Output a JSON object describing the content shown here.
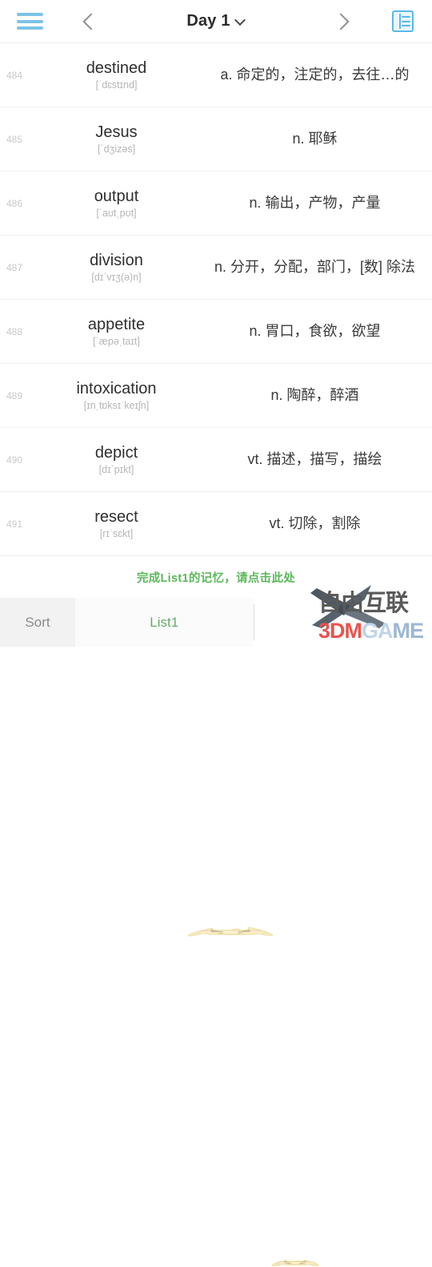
{
  "header": {
    "menu_icon": "hamburger-menu-icon",
    "prev_icon": "chevron-left-icon",
    "title": "Day 1",
    "caret_icon": "chevron-down-icon",
    "next_icon": "chevron-right-icon",
    "grid_icon": "table-list-icon"
  },
  "words": [
    {
      "index": "484",
      "word": "destined",
      "ipa": "[ˈdɛstɪnd]",
      "definition": "a. 命定的，注定的，去往…的"
    },
    {
      "index": "485",
      "word": "Jesus",
      "ipa": "[ˈdʒizəs]",
      "definition": "n. 耶稣"
    },
    {
      "index": "486",
      "word": "output",
      "ipa": "[ˈaʊtˌpʊt]",
      "definition": "n. 输出，产物，产量"
    },
    {
      "index": "487",
      "word": "division",
      "ipa": "[dɪˈvɪʒ(ə)n]",
      "definition": "n. 分开，分配，部门，[数] 除法"
    },
    {
      "index": "488",
      "word": "appetite",
      "ipa": "[ˈæpəˌtaɪt]",
      "definition": "n. 胃口，食欲，欲望"
    },
    {
      "index": "489",
      "word": "intoxication",
      "ipa": "[ɪnˌtɒksɪˈkeɪʃn]",
      "definition": "n. 陶醉，醉酒"
    },
    {
      "index": "490",
      "word": "depict",
      "ipa": "[dɪˈpɪkt]",
      "definition": "vt. 描述，描写，描绘"
    },
    {
      "index": "491",
      "word": "resect",
      "ipa": "[rɪˈsɛkt]",
      "definition": "vt. 切除，割除"
    }
  ],
  "hint": {
    "text": "完成List1的记忆，请点击此处",
    "color": "#5cb85c"
  },
  "tabbar": {
    "sort_label": "Sort",
    "list_label": "List1"
  },
  "watermarks": {
    "site_name": "自由互联",
    "game_name_1": "3DM",
    "game_name_2": "GA",
    "game_name_3": "ME",
    "mascot": "chick-mascot",
    "x_logo": "x-swoosh-logo"
  },
  "colors": {
    "accent_blue": "#5bb8e8",
    "accent_green": "#5cb85c",
    "index_gray": "#c9c9c9",
    "ipa_gray": "#b6b6b6"
  }
}
